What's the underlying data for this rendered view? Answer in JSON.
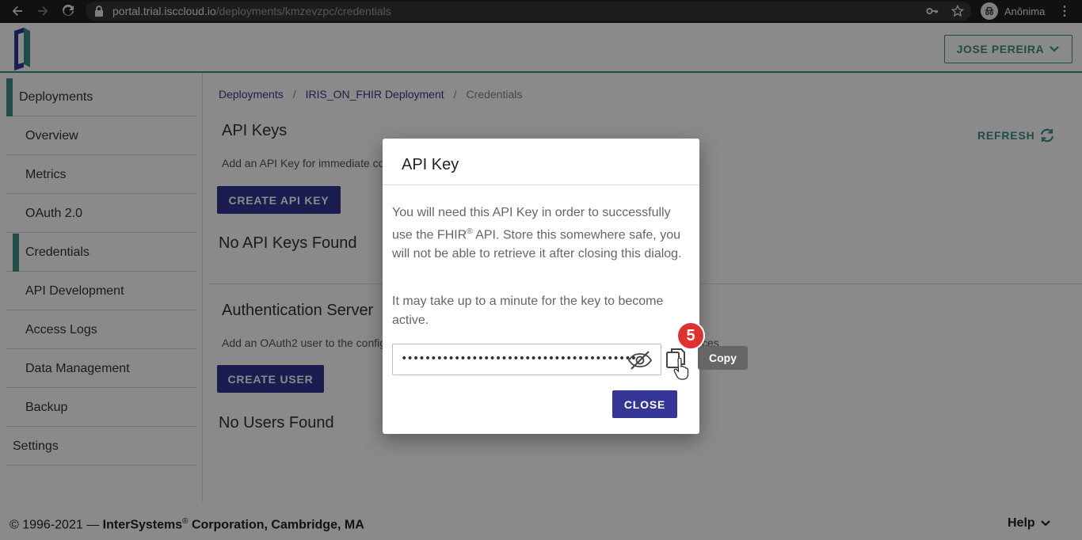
{
  "browser": {
    "url_host": "portal.trial.isccloud.io",
    "url_path": "/deployments/kmzevzpc/credentials",
    "profile_name": "Anônima"
  },
  "header": {
    "user_menu_label": "JOSE PEREIRA"
  },
  "sidebar": {
    "items": [
      {
        "label": "Deployments"
      },
      {
        "label": "Overview"
      },
      {
        "label": "Metrics"
      },
      {
        "label": "OAuth 2.0"
      },
      {
        "label": "Credentials"
      },
      {
        "label": "API Development"
      },
      {
        "label": "Access Logs"
      },
      {
        "label": "Data Management"
      },
      {
        "label": "Backup"
      },
      {
        "label": "Settings"
      }
    ]
  },
  "breadcrumb": {
    "items": [
      "Deployments",
      "IRIS_ON_FHIR Deployment",
      "Credentials"
    ],
    "separator": "/"
  },
  "main": {
    "refresh_label": "REFRESH",
    "api_keys": {
      "title": "API Keys",
      "description": "Add an API Key for immediate co",
      "button_label": "CREATE API KEY",
      "empty_text": "No API Keys Found"
    },
    "auth_server": {
      "title": "Authentication Server",
      "description": "Add an OAuth2 user to the config",
      "description_tail": "ces",
      "button_label": "CREATE USER",
      "empty_text": "No Users Found"
    }
  },
  "dialog": {
    "title": "API Key",
    "paragraph1_a": "You will need this API Key in order to successfully use the FHIR",
    "paragraph1_sup": "®",
    "paragraph1_b": " API. Store this somewhere safe, you will not be able to retrieve it after closing this dialog.",
    "paragraph2": "It may take up to a minute for the key to become active.",
    "key_masked": "••••••••••••••••••••••••••••••••••••••••",
    "close_label": "CLOSE",
    "copy_tooltip": "Copy"
  },
  "step_badge": "5",
  "footer": {
    "copyright_prefix": "© 1996-2021 — ",
    "company": "InterSystems",
    "company_sup": "®",
    "company_suffix": " Corporation, Cambridge, MA",
    "help_label": "Help"
  },
  "colors": {
    "accent_teal": "#3a8f86",
    "primary_indigo": "#333695",
    "badge_red": "#e03131"
  }
}
